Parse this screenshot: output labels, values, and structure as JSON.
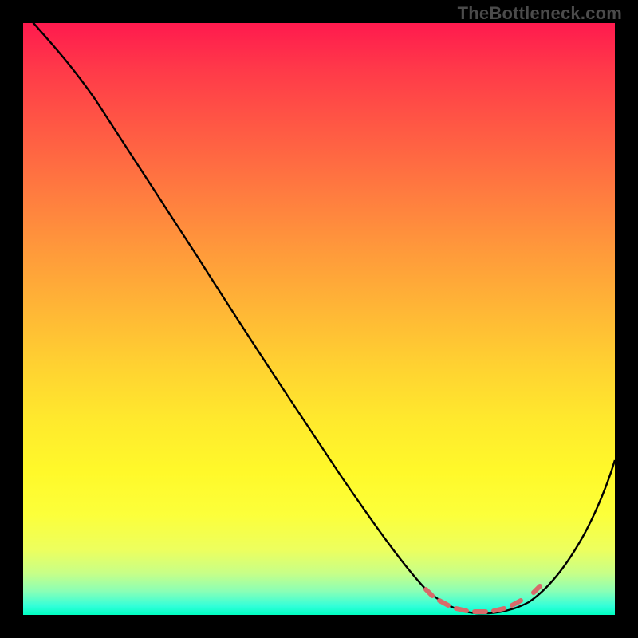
{
  "watermark": "TheBottleneck.com",
  "colors": {
    "page_bg": "#000000",
    "curve_stroke": "#000000",
    "marker_stroke": "#d86a6a",
    "watermark_text": "#4b4b4b",
    "gradient_top": "#ff1a4e",
    "gradient_bottom": "#00ffc2"
  },
  "chart_data": {
    "type": "line",
    "title": "",
    "xlabel": "",
    "ylabel": "",
    "xlim": [
      0,
      100
    ],
    "ylim": [
      0,
      100
    ],
    "grid": false,
    "legend": false,
    "note": "axes hidden; background color encodes y from red (high) through yellow to green (low); plot region inset inside black border",
    "series": [
      {
        "name": "bottleneck-curve",
        "x": [
          0,
          2,
          5,
          10,
          15,
          20,
          25,
          30,
          35,
          40,
          45,
          50,
          55,
          60,
          63,
          66,
          69,
          72,
          75,
          78,
          81,
          84,
          87,
          90,
          93,
          96,
          100
        ],
        "y": [
          102,
          100,
          97.5,
          92,
          86,
          79.5,
          73,
          66.5,
          60,
          53.5,
          47,
          40.5,
          34,
          27.5,
          22.5,
          17,
          12,
          7,
          3.5,
          1.5,
          0.8,
          1.2,
          3,
          6.5,
          11.5,
          18,
          29
        ]
      }
    ],
    "markers": {
      "name": "highlighted-range",
      "style": "dashed-segments",
      "x": [
        70,
        72,
        74,
        76,
        78,
        80,
        82,
        84,
        86,
        88
      ],
      "y": [
        5.5,
        3.5,
        2,
        1.3,
        0.9,
        0.8,
        1.0,
        1.5,
        2.8,
        4.8
      ]
    }
  }
}
